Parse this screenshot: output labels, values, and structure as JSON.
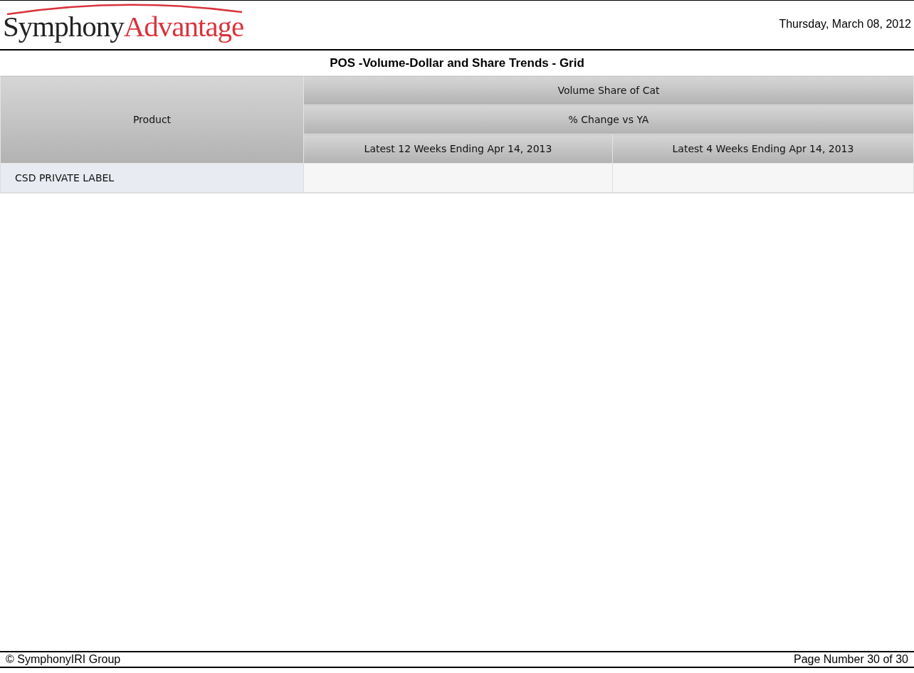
{
  "header": {
    "logo": {
      "first": "Symphony",
      "second": "Advantage"
    },
    "date": "Thursday, March 08, 2012"
  },
  "report_title": "POS -Volume-Dollar and Share Trends - Grid",
  "table": {
    "row_header": "Product",
    "group_header": "Volume Share of Cat",
    "subgroup_header": "% Change vs YA",
    "columns": [
      "Latest 12 Weeks Ending Apr 14, 2013",
      "Latest 4 Weeks Ending Apr 14, 2013"
    ],
    "rows": [
      {
        "product": "CSD PRIVATE LABEL"
      }
    ]
  },
  "footer": {
    "copyright": "© SymphonyIRI Group",
    "page": "Page Number 30 of 30"
  }
}
